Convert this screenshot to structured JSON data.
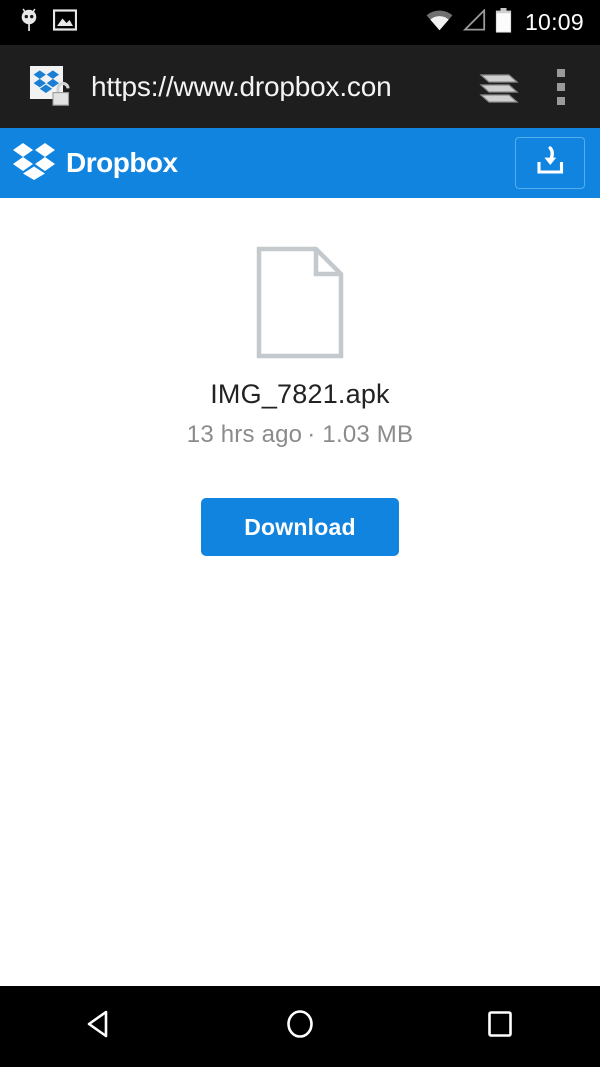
{
  "status_bar": {
    "time": "10:09",
    "left_icons": [
      {
        "name": "android-robot-icon"
      },
      {
        "name": "photo-icon"
      }
    ],
    "right_icons": [
      {
        "name": "wifi-icon"
      },
      {
        "name": "cell-signal-icon"
      },
      {
        "name": "battery-icon"
      }
    ]
  },
  "browser_bar": {
    "url": "https://www.dropbox.con",
    "favicon_name": "dropbox-favicon",
    "lock_icon_name": "unlocked-padlock-icon",
    "tabs_icon_name": "tab-stack-icon",
    "menu_icon_name": "overflow-menu-icon"
  },
  "app_header": {
    "brand": "Dropbox",
    "logo_name": "dropbox-logo-icon",
    "save_button_icon": "save-to-dropbox-icon"
  },
  "file": {
    "icon_name": "document-file-icon",
    "name": "IMG_7821.apk",
    "modified": "13 hrs ago",
    "separator": "·",
    "size": "1.03 MB",
    "download_label": "Download"
  },
  "nav_bar": {
    "back": "back-button",
    "home": "home-button",
    "recents": "recents-button"
  },
  "colors": {
    "brand_blue": "#1184e0",
    "status_bar_bg": "#000000",
    "browser_bar_bg": "#1e1e1e",
    "content_bg": "#ffffff",
    "filename_color": "#222222",
    "meta_color": "#8b8b8b"
  }
}
